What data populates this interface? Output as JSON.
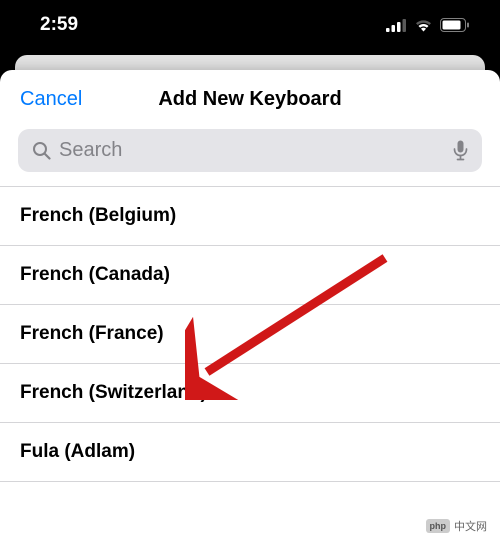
{
  "status": {
    "time": "2:59"
  },
  "modal": {
    "cancel_label": "Cancel",
    "title": "Add New Keyboard"
  },
  "search": {
    "placeholder": "Search"
  },
  "keyboards": {
    "item0": "French (Belgium)",
    "item1": "French (Canada)",
    "item2": "French (France)",
    "item3": "French (Switzerland)",
    "item4": "Fula (Adlam)"
  },
  "watermark": {
    "badge": "php",
    "text": "中文网"
  },
  "colors": {
    "accent": "#007aff",
    "arrow": "#d01818"
  }
}
